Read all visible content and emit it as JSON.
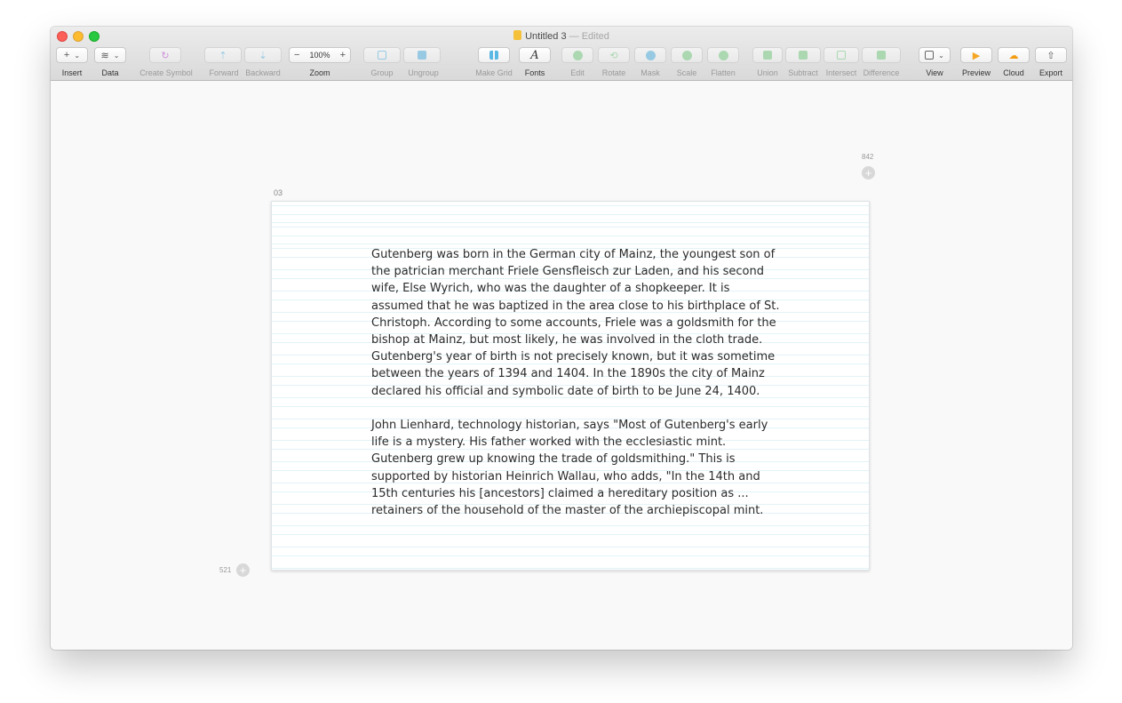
{
  "window": {
    "title": "Untitled 3",
    "title_separator": "—",
    "title_status": "Edited"
  },
  "toolbar": {
    "insert": {
      "icon": "+",
      "label": "Insert"
    },
    "data": {
      "label": "Data"
    },
    "create_symbol": {
      "label": "Create Symbol"
    },
    "forward": {
      "label": "Forward"
    },
    "backward": {
      "label": "Backward"
    },
    "zoom": {
      "minus": "−",
      "value": "100%",
      "plus": "+",
      "label": "Zoom"
    },
    "group": {
      "label": "Group"
    },
    "ungroup": {
      "label": "Ungroup"
    },
    "make_grid": {
      "label": "Make Grid"
    },
    "fonts": {
      "icon": "A",
      "label": "Fonts"
    },
    "edit": {
      "label": "Edit"
    },
    "rotate": {
      "label": "Rotate"
    },
    "mask": {
      "label": "Mask"
    },
    "scale": {
      "label": "Scale"
    },
    "flatten": {
      "label": "Flatten"
    },
    "union": {
      "label": "Union"
    },
    "subtract": {
      "label": "Subtract"
    },
    "intersect": {
      "label": "Intersect"
    },
    "difference": {
      "label": "Difference"
    },
    "view": {
      "label": "View"
    },
    "preview": {
      "label": "Preview"
    },
    "cloud": {
      "label": "Cloud"
    },
    "export": {
      "label": "Export"
    }
  },
  "colors": {
    "accent_blue": "#5bb7e3",
    "accent_green": "#7fd08a",
    "preview_orange": "#f5a623",
    "cloud_orange": "#f39c12",
    "grid_line": "#c6e7ef"
  },
  "canvas": {
    "artboard_name": "03",
    "ruler_top_value": "842",
    "ruler_left_value": "521",
    "add_icon": "+",
    "paragraphs": [
      "Gutenberg was born in the German city of Mainz, the youngest son of the patrician merchant Friele Gensfleisch zur Laden, and his second wife, Else Wyrich, who was the daughter of a shopkeeper. It is assumed that he was baptized in the area close to his birthplace of St. Christoph. According to some accounts, Friele was a goldsmith for the bishop at Mainz, but most likely, he was involved in the cloth trade. Gutenberg's year of birth is not precisely known, but it was sometime between the years of 1394 and 1404. In the 1890s the city of Mainz declared his official and symbolic date of birth to be June 24, 1400.",
      "John Lienhard, technology historian, says \"Most of Gutenberg's early life is a mystery. His father worked with the ecclesiastic mint. Gutenberg grew up knowing the trade of goldsmithing.\" This is supported by historian Heinrich Wallau, who adds, \"In the 14th and 15th centuries his [ancestors] claimed a hereditary position as ... retainers of the household of the master of the archiepiscopal mint."
    ]
  }
}
